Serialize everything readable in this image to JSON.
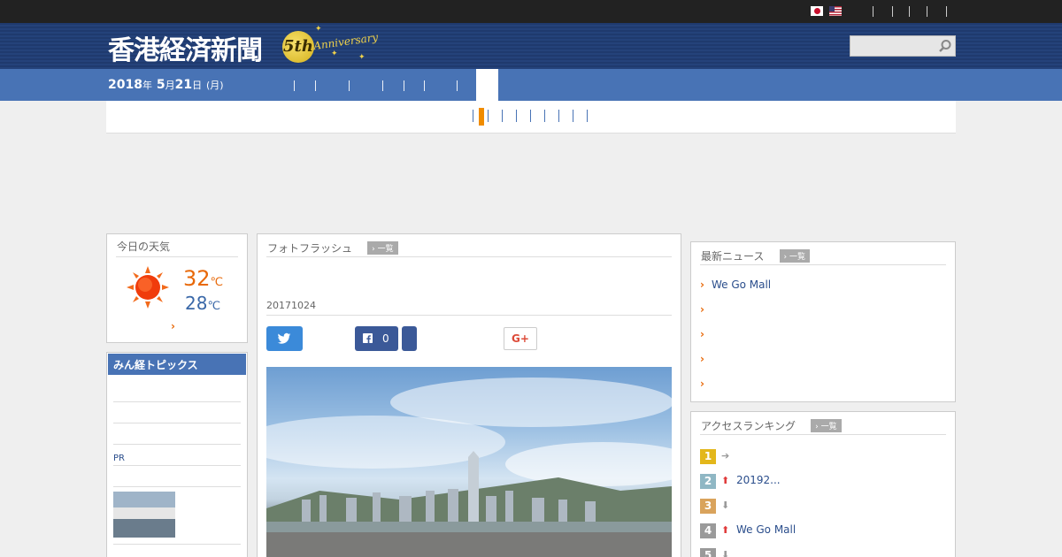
{
  "header": {
    "logo_text": "香港経済新聞",
    "anniversary_number": "5th",
    "anniversary_text": "Anniversary",
    "search_placeholder": ""
  },
  "nav": {
    "date_year": "2018",
    "date_year_suffix": "年",
    "date_month": "5",
    "date_month_suffix": "月",
    "date_day": "21",
    "date_day_suffix": "日",
    "date_weekday": "(月)"
  },
  "weather": {
    "title": "今日の天気",
    "high": "32",
    "low": "28",
    "unit": "℃",
    "icon": "sun-icon"
  },
  "minkei": {
    "title": "みん経トピックス",
    "pr_label": "PR"
  },
  "main": {
    "section_title": "フォトフラッシュ",
    "more_label": "一覧",
    "date_label": "20171024",
    "facebook_count": "0",
    "gplus_label": "G+"
  },
  "latest_news": {
    "title": "最新ニュース",
    "more_label": "一覧",
    "items": [
      "We Go Mall",
      "",
      "",
      "",
      ""
    ]
  },
  "ranking": {
    "title": "アクセスランキング",
    "more_label": "一覧",
    "items": [
      {
        "rank": "1",
        "trend": "same",
        "text": ""
      },
      {
        "rank": "2",
        "trend": "up",
        "text": "20192..."
      },
      {
        "rank": "3",
        "trend": "down",
        "text": ""
      },
      {
        "rank": "4",
        "trend": "up",
        "text": "We Go Mall"
      },
      {
        "rank": "5",
        "trend": "down",
        "text": ""
      }
    ]
  },
  "colors": {
    "nav_blue": "#4873b5",
    "header_navy": "#1f3a6e",
    "accent_orange": "#e8690a",
    "link_blue": "#2b4e8c"
  }
}
